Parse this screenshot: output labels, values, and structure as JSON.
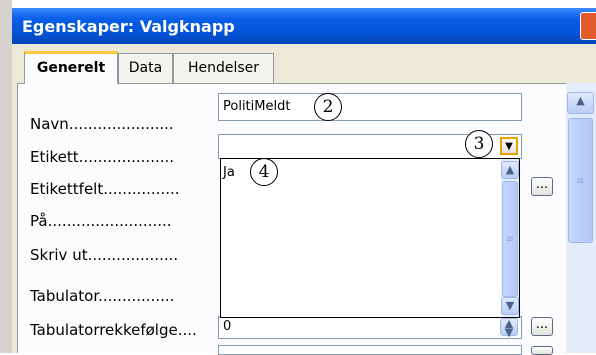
{
  "window": {
    "title": "Egenskaper: Valgknapp"
  },
  "tabs": [
    {
      "label": "Generelt",
      "active": true
    },
    {
      "label": "Data",
      "active": false
    },
    {
      "label": "Hendelser",
      "active": false
    }
  ],
  "fields": [
    {
      "label": "Navn......................",
      "value": "PolitiMeldt"
    },
    {
      "label": "Etikett....................",
      "value": ""
    },
    {
      "label": "Etikettfelt................",
      "value": ""
    },
    {
      "label": "På..........................",
      "value": ""
    },
    {
      "label": "Skriv ut...................",
      "value": ""
    },
    {
      "label": "Tabulator................",
      "value": ""
    },
    {
      "label": "Tabulatorrekkefølge....",
      "value": "0"
    }
  ],
  "dropdown": {
    "selected": "Ja"
  },
  "callouts": [
    "2",
    "3",
    "4"
  ],
  "buttons": {
    "browse": "...",
    "dropdown_arrow": "▼",
    "scroll_up": "▲",
    "scroll_down": "▼",
    "close": "×"
  },
  "colors": {
    "titlebar": "#0353d6",
    "accent_tab": "#ffc83c",
    "panel": "#fcfcfe"
  }
}
